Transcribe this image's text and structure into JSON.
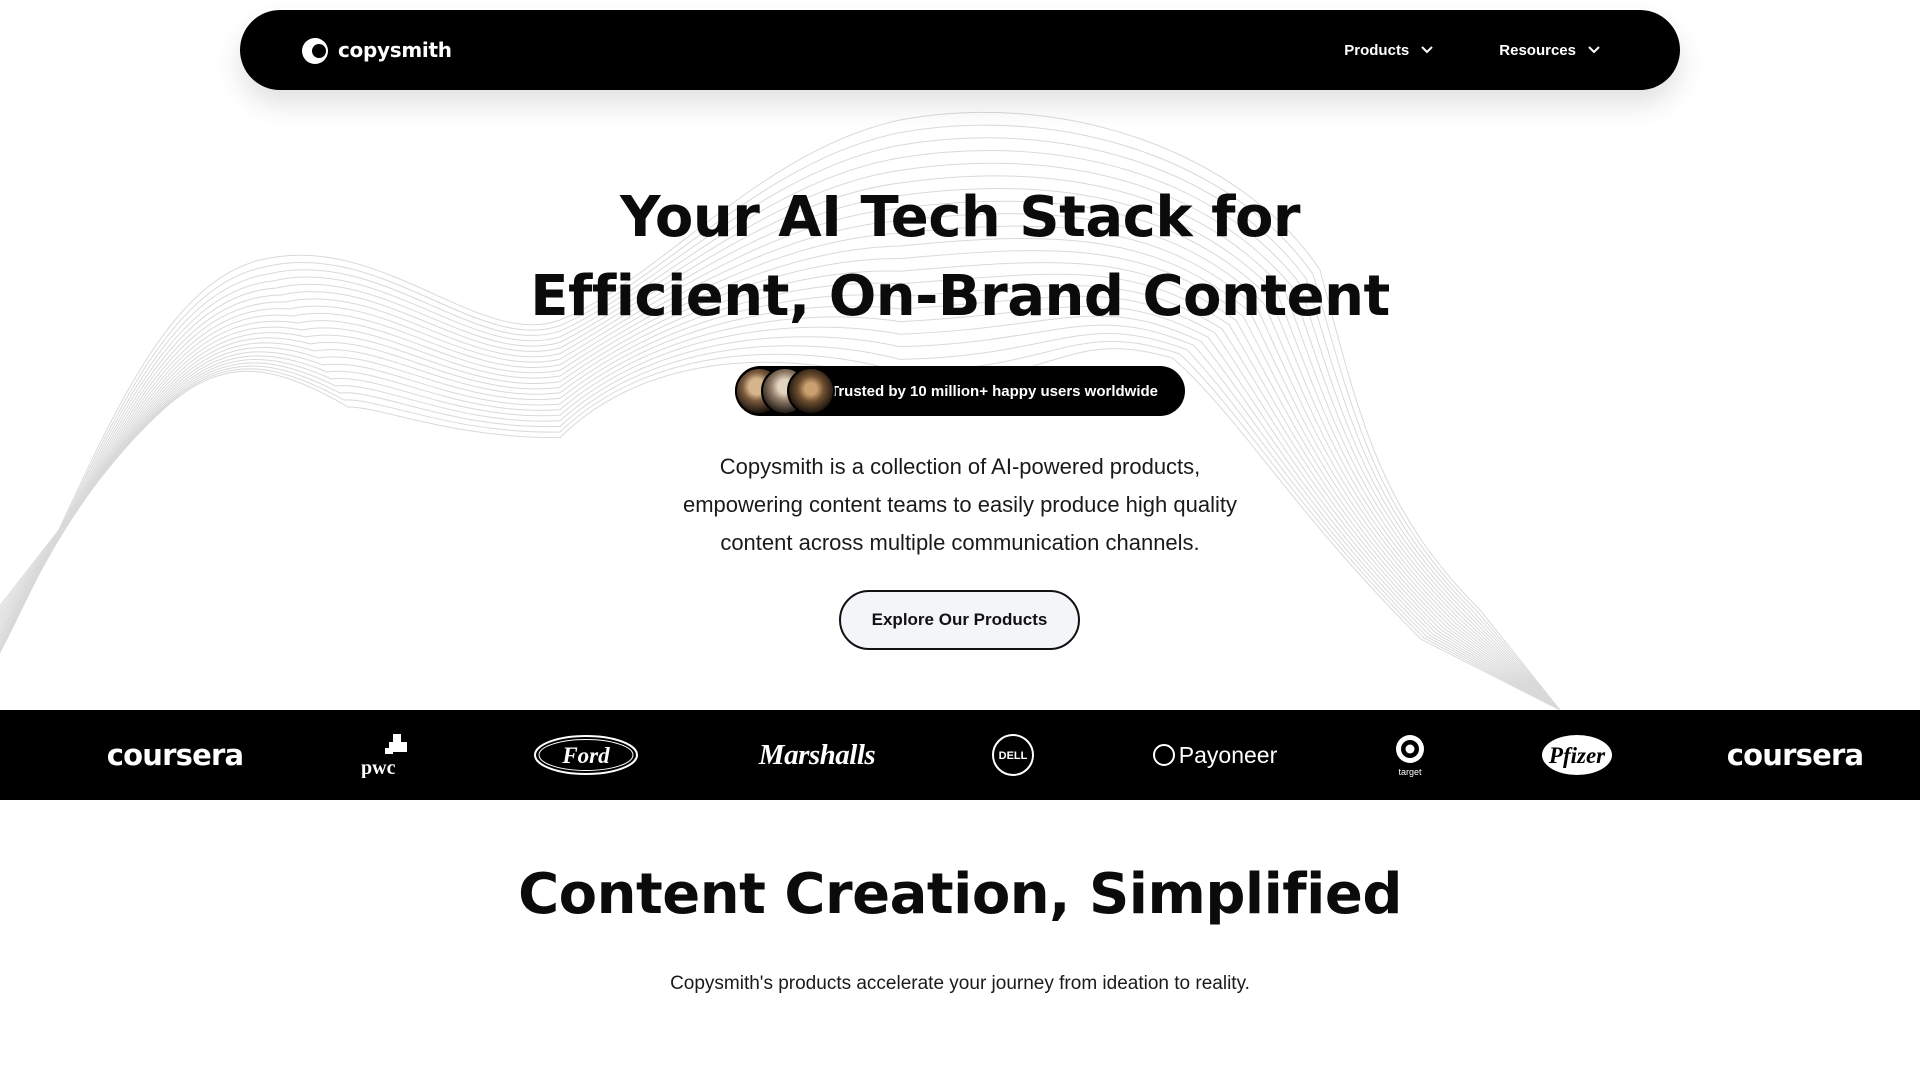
{
  "nav": {
    "brand": "copysmith",
    "items": [
      {
        "label": "Products",
        "icon": "chevron-down-icon"
      },
      {
        "label": "Resources",
        "icon": "chevron-down-icon"
      }
    ]
  },
  "hero": {
    "title_line1": "Your AI Tech Stack for",
    "title_line2": "Efficient, On-Brand Content",
    "trust_text": "Trusted by 10 million+ happy users worldwide",
    "description": [
      "Copysmith is a collection of AI-powered products,",
      "empowering content teams to easily produce high quality",
      "content across multiple communication channels."
    ],
    "cta_label": "Explore Our Products"
  },
  "logos": [
    {
      "name": "coursera",
      "text": "coursera"
    },
    {
      "name": "pwc",
      "text": "pwc"
    },
    {
      "name": "ford",
      "text": "Ford"
    },
    {
      "name": "marshalls",
      "text": "Marshalls"
    },
    {
      "name": "dell",
      "text": "DELL"
    },
    {
      "name": "payoneer",
      "text": "Payoneer"
    },
    {
      "name": "target",
      "text": "target"
    },
    {
      "name": "pfizer",
      "text": "Pfizer"
    },
    {
      "name": "coursera",
      "text": "coursera"
    }
  ],
  "section": {
    "title": "Content Creation, Simplified",
    "subtitle": "Copysmith's products accelerate your journey from ideation to reality."
  },
  "colors": {
    "nav_bg": "#000000",
    "logo_band_bg": "#000000",
    "cta_bg": "#f3f5f9",
    "text": "#111111"
  }
}
